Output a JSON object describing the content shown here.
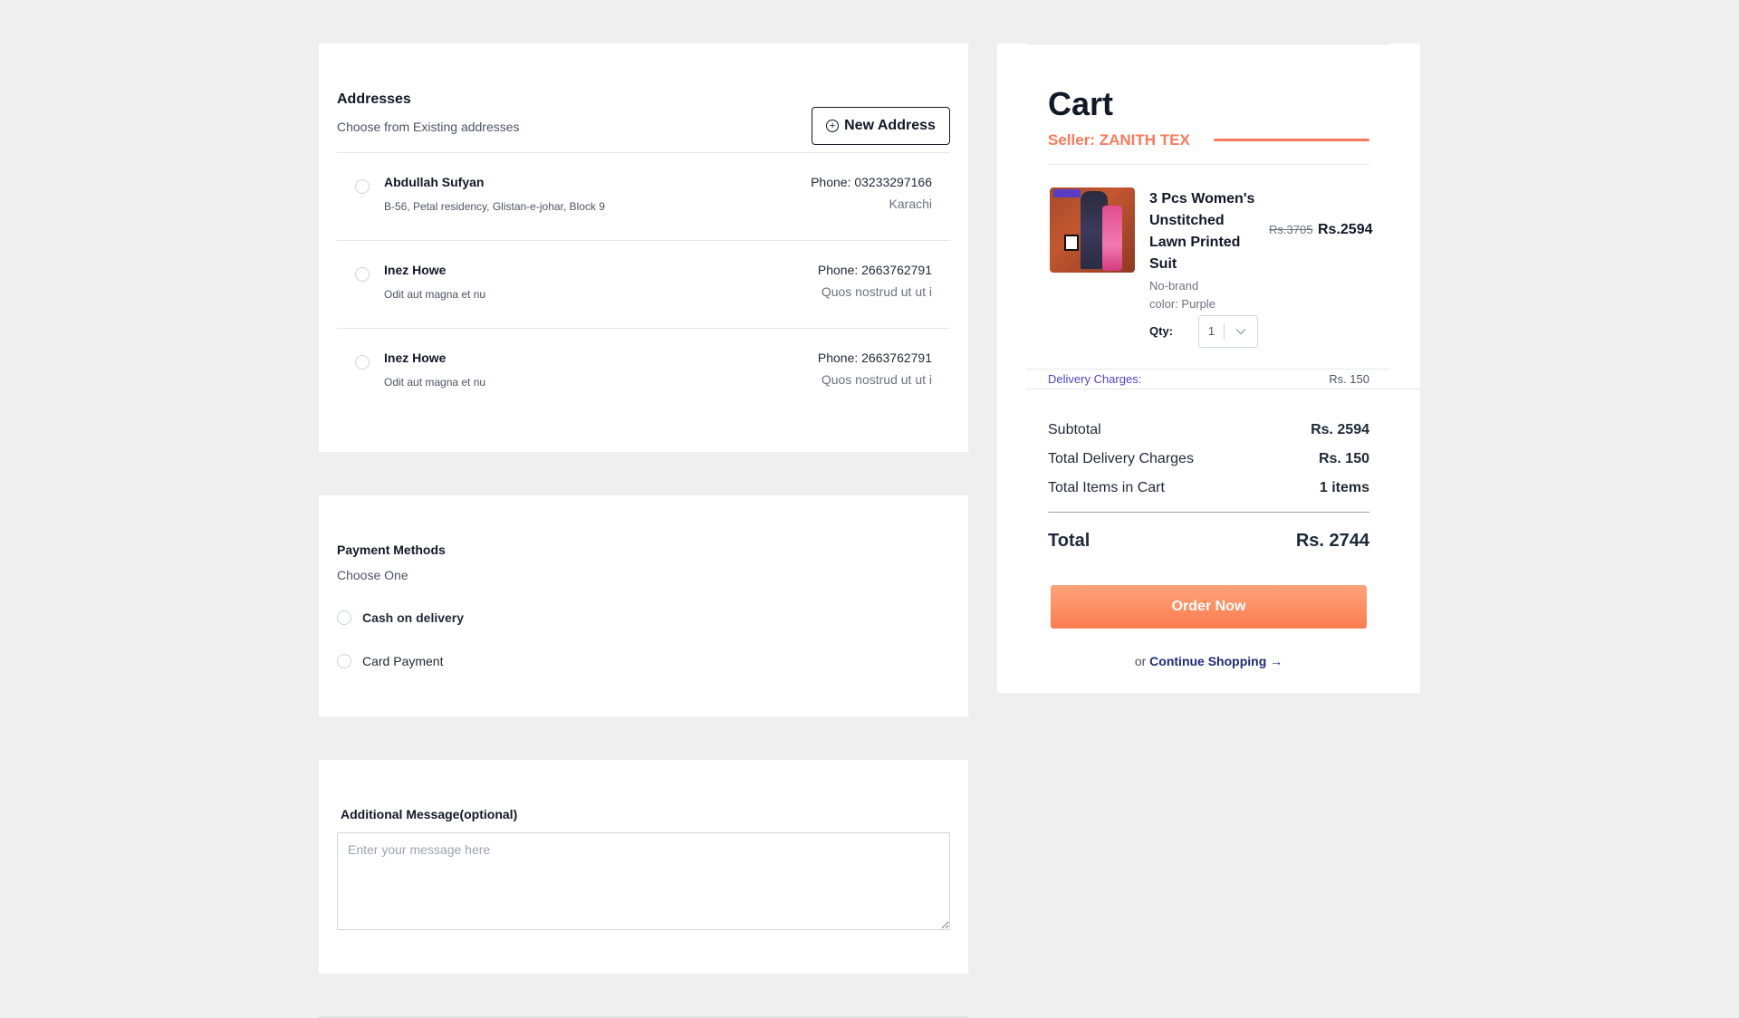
{
  "addresses": {
    "title": "Addresses",
    "subtitle": "Choose from Existing addresses",
    "new_button": "New Address",
    "items": [
      {
        "name": "Abdullah Sufyan",
        "address": "B-56, Petal residency, Glistan-e-johar, Block 9",
        "phone": "Phone: 03233297166",
        "city": "Karachi"
      },
      {
        "name": "Inez Howe",
        "address": "Odit aut magna et nu",
        "phone": "Phone: 2663762791",
        "city": "Quos nostrud ut ut i"
      },
      {
        "name": "Inez Howe",
        "address": "Odit aut magna et nu",
        "phone": "Phone: 2663762791",
        "city": "Quos nostrud ut ut i"
      }
    ]
  },
  "payment": {
    "title": "Payment Methods",
    "subtitle": "Choose One",
    "options": [
      "Cash on delivery",
      "Card Payment"
    ]
  },
  "message": {
    "title": "Additional Message(optional)",
    "placeholder": "Enter your message here"
  },
  "cart": {
    "title": "Cart",
    "seller": "Seller: ZANITH TEX",
    "product": {
      "name": "3 Pcs Women's Unstitched Lawn Printed Suit",
      "brand": "No-brand",
      "color": "color: Purple",
      "old_price": "Rs.3705",
      "price": "Rs.2594",
      "qty_label": "Qty:",
      "qty": "1"
    },
    "delivery_label": "Delivery Charges:",
    "delivery_value": "Rs. 150",
    "summary": {
      "subtotal_label": "Subtotal",
      "subtotal_value": "Rs. 2594",
      "delivery_label": "Total Delivery Charges",
      "delivery_value": "Rs. 150",
      "items_label": "Total Items in Cart",
      "items_value": "1 items",
      "total_label": "Total",
      "total_value": "Rs. 2744"
    },
    "order_button": "Order Now",
    "continue_prefix": "or",
    "continue_link": "Continue Shopping →"
  },
  "colors": {
    "accent": "#f97a5c",
    "link": "#1e2a78",
    "delivery_label": "#4f46c8"
  }
}
